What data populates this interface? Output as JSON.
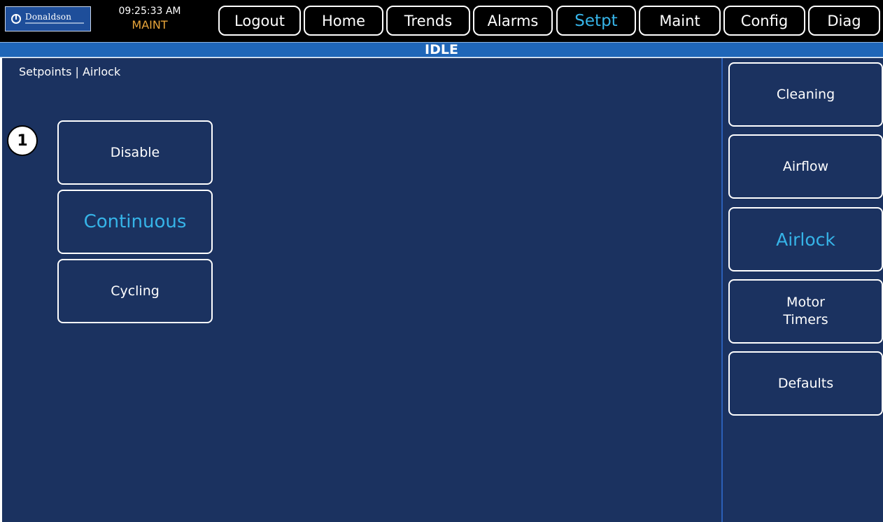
{
  "logo": {
    "brand_text": "Donaldson",
    "icon": "donaldson-logo-mark"
  },
  "header": {
    "time": "09:25:33 AM",
    "mode": "MAINT"
  },
  "nav": {
    "logout": "Logout",
    "home": "Home",
    "trends": "Trends",
    "alarms": "Alarms",
    "setpt": "Setpt",
    "maint": "Maint",
    "config": "Config",
    "diag": "Diag",
    "active": "Setpt"
  },
  "status": {
    "text": "IDLE"
  },
  "page": {
    "breadcrumb": "Setpoints | Airlock"
  },
  "step_badge": "1",
  "options": {
    "disable": "Disable",
    "continuous": "Continuous",
    "cycling": "Cycling",
    "selected": "Continuous"
  },
  "side_menu": {
    "cleaning": "Cleaning",
    "airflow": "Airflow",
    "airlock": "Airlock",
    "motor_timers_line1": "Motor",
    "motor_timers_line2": "Timers",
    "defaults": "Defaults",
    "selected": "Airlock"
  },
  "colors": {
    "background": "#1b3260",
    "header": "#000000",
    "status_bar": "#1f66b8",
    "accent_selected": "#36b4e8",
    "mode_text": "#e8a53a",
    "button_border": "#ffffff"
  }
}
